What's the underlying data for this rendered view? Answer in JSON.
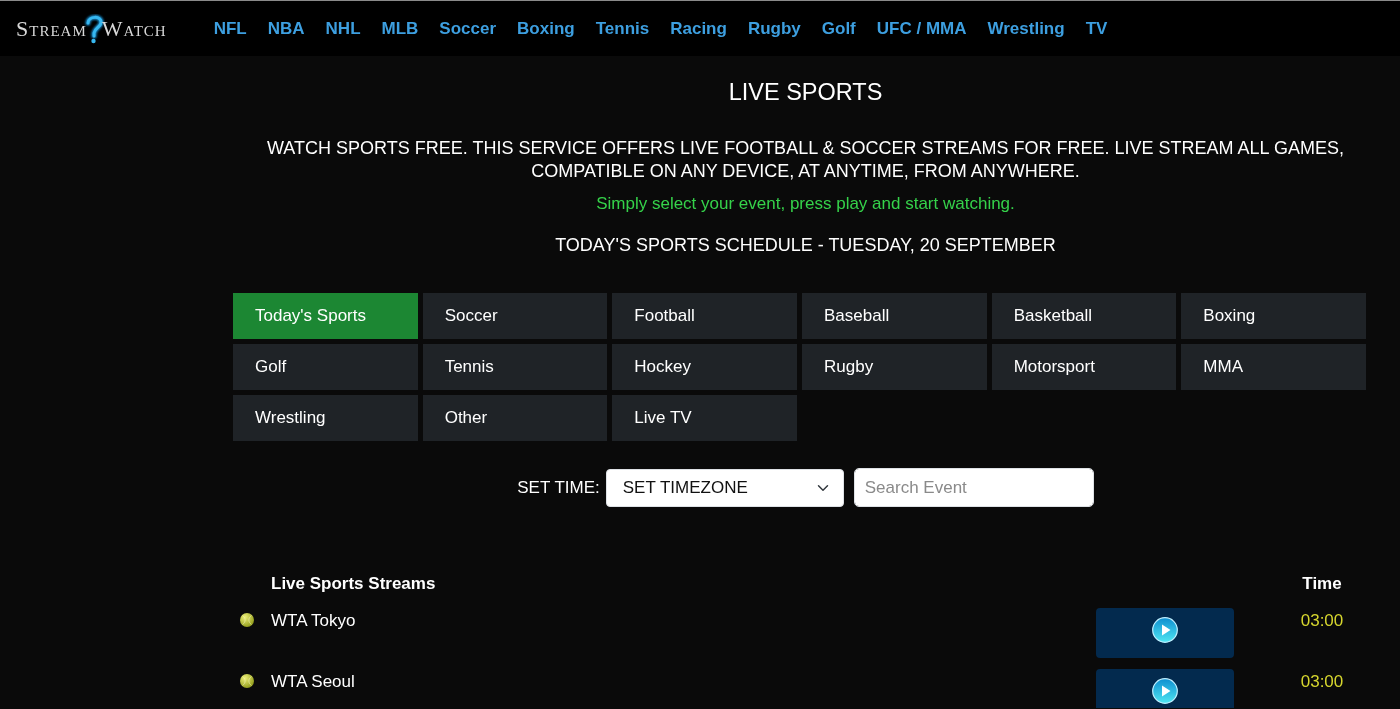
{
  "logo": {
    "word_1": "Stream",
    "word_2": "Watch"
  },
  "nav": [
    "NFL",
    "NBA",
    "NHL",
    "MLB",
    "Soccer",
    "Boxing",
    "Tennis",
    "Racing",
    "Rugby",
    "Golf",
    "UFC / MMA",
    "Wrestling",
    "TV"
  ],
  "title": "LIVE SPORTS",
  "intro": "WATCH SPORTS FREE. THIS SERVICE OFFERS LIVE FOOTBALL & SOCCER STREAMS FOR FREE. LIVE STREAM ALL GAMES, COMPATIBLE ON ANY DEVICE, AT ANYTIME, FROM ANYWHERE.",
  "tagline": "Simply select your event, press play and start watching.",
  "schedule_heading": "TODAY'S SPORTS SCHEDULE - TUESDAY, 20 SEPTEMBER",
  "categories": [
    {
      "label": "Today's Sports",
      "selected": true
    },
    {
      "label": "Soccer",
      "selected": false
    },
    {
      "label": "Football",
      "selected": false
    },
    {
      "label": "Baseball",
      "selected": false
    },
    {
      "label": "Basketball",
      "selected": false
    },
    {
      "label": "Boxing",
      "selected": false
    },
    {
      "label": "Golf",
      "selected": false
    },
    {
      "label": "Tennis",
      "selected": false
    },
    {
      "label": "Hockey",
      "selected": false
    },
    {
      "label": "Rugby",
      "selected": false
    },
    {
      "label": "Motorsport",
      "selected": false
    },
    {
      "label": "MMA",
      "selected": false
    },
    {
      "label": "Wrestling",
      "selected": false
    },
    {
      "label": "Other",
      "selected": false
    },
    {
      "label": "Live TV",
      "selected": false
    }
  ],
  "filters": {
    "label": "SET TIME:",
    "timezone": "SET TIMEZONE",
    "search": {
      "placeholder": "Search Event"
    }
  },
  "table": {
    "columns": [
      "Live Sports Streams",
      "Time"
    ],
    "rows": [
      {
        "event": "WTA Tokyo",
        "time": "03:00"
      },
      {
        "event": "WTA Seoul",
        "time": "03:00"
      }
    ]
  }
}
